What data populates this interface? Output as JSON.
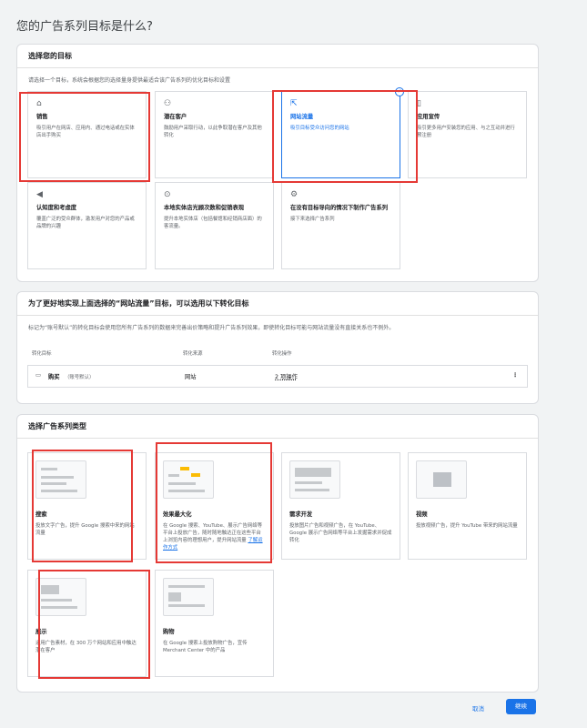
{
  "page_title": "您的广告系列目标是什么?",
  "goal_section": {
    "heading": "选择您的目标",
    "description": "请选择一个目标，系统会根据您的选择量身提供最适合该广告系列的优化目标和设置",
    "goals": [
      {
        "icon": "tag-icon",
        "title": "销售",
        "desc": "吸引用户在网店、应用内、通过电话或在实体店出手购买",
        "selected": false
      },
      {
        "icon": "people-icon",
        "title": "潜在客户",
        "desc": "鼓励用户采取行动，以此争取潜在客户及其他转化",
        "selected": false
      },
      {
        "icon": "cursor-click-icon",
        "title": "网站流量",
        "desc": "吸引目标受众访问您的网站",
        "selected": true
      },
      {
        "icon": "phone-icon",
        "title": "应用宣传",
        "desc": "吸引更多用户安装您的应用、与之互动并进行预注册",
        "selected": false
      },
      {
        "icon": "megaphone-icon",
        "title": "认知度和考虑度",
        "desc": "覆盖广泛的受众群体，激发用户对您的产品或品牌的兴趣",
        "selected": false
      },
      {
        "icon": "location-pin-icon",
        "title": "本地实体店光顾次数和促销表现",
        "desc": "提升本地实体店（包括餐馆和经销商店面）的客流量。",
        "selected": false
      },
      {
        "icon": "gear-icon",
        "title": "在没有目标导向的情况下制作广告系列",
        "desc": "接下来选择广告系列",
        "selected": false
      }
    ]
  },
  "conversion_section": {
    "heading": "为了更好地实现上面选择的“网站流量”目标，可以选用以下转化目标",
    "description": "标记为“账号默认”的转化目标会使用您所有广告系列的数据来完善出价策略和提升广告系列效果，即使转化目标可能与网站流量没有直接关系也不例外。",
    "columns": [
      "转化目标",
      "转化来源",
      "转化操作"
    ],
    "row": {
      "icon": "credit-card-icon",
      "goal": "购买",
      "goal_tag": "（账号默认）",
      "source": "网站",
      "actions": "2 项操作"
    }
  },
  "campaign_section": {
    "heading": "选择广告系列类型",
    "types": [
      {
        "title": "搜索",
        "desc": "投放文字广告，提升 Google 搜索中来的网站流量"
      },
      {
        "title": "效果最大化",
        "desc": "在 Google 搜索、YouTube、展示广告网络等平台上投放广告，随时随地触达正在这些平台上浏览内容的理想用户，提升网站流量",
        "link": "了解运作方式"
      },
      {
        "title": "需求开发",
        "desc": "投放图片广告和视频广告，在 YouTube、Google 展示广告网络等平台上发掘需求并促成转化"
      },
      {
        "title": "视频",
        "desc": "投放视频广告，提升 YouTube 带来的网站流量"
      },
      {
        "title": "展示",
        "desc": "运用广告素材，在 300 万个网站和应用中触达潜在客户"
      },
      {
        "title": "购物",
        "desc": "在 Google 搜索上投放购物广告，宣传 Merchant Center 中的产品"
      }
    ]
  },
  "footer": {
    "cancel": "取消",
    "continue": "继续"
  }
}
